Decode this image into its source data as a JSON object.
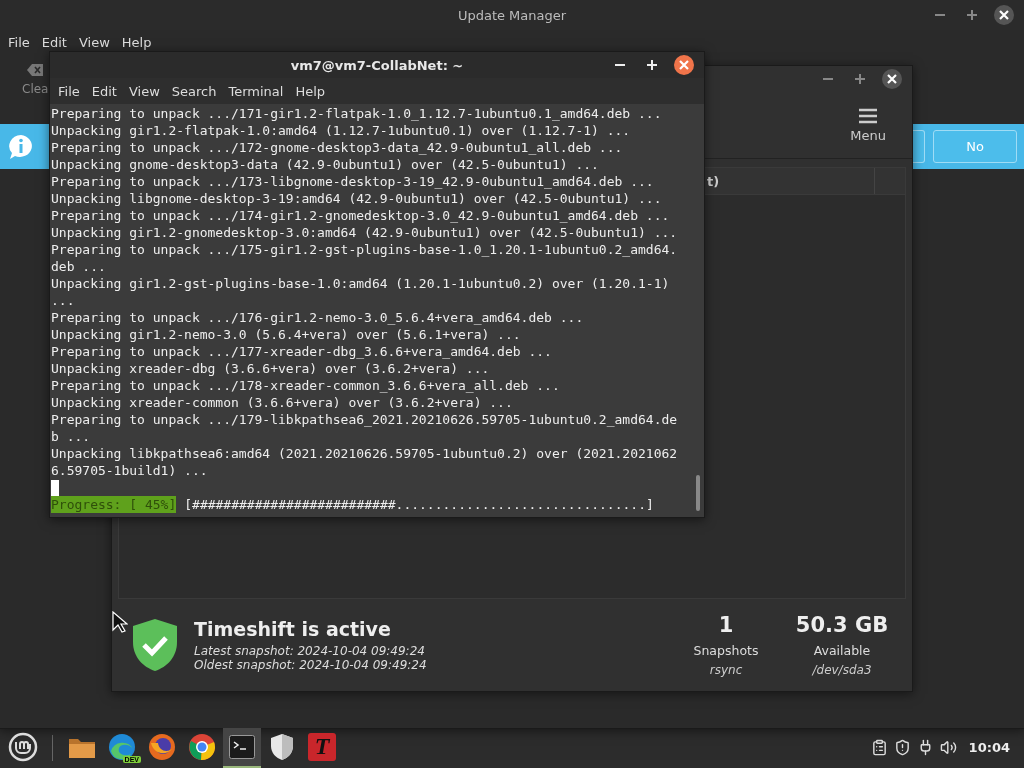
{
  "update_manager": {
    "title": "Update Manager",
    "focused": false,
    "menu": [
      "File",
      "Edit",
      "View",
      "Help"
    ],
    "toolbar_label": "Clea",
    "info_bar": {
      "buttons": [
        "No"
      ]
    }
  },
  "timeshift": {
    "toolbar_label": "Menu",
    "column_header": "t)",
    "status": {
      "title": "Timeshift is active",
      "latest": "Latest snapshot: 2024-10-04 09:49:24",
      "oldest": "Oldest snapshot: 2024-10-04 09:49:24",
      "stats": [
        {
          "value": "1",
          "label": "Snapshots",
          "sub": "rsync"
        },
        {
          "value": "50.3 GB",
          "label": "Available",
          "sub": "/dev/sda3"
        }
      ]
    }
  },
  "terminal": {
    "title": "vm7@vm7-CollabNet: ~",
    "focused": true,
    "menu": [
      "File",
      "Edit",
      "View",
      "Search",
      "Terminal",
      "Help"
    ],
    "lines": [
      "Preparing to unpack .../171-gir1.2-flatpak-1.0_1.12.7-1ubuntu0.1_amd64.deb ...",
      "Unpacking gir1.2-flatpak-1.0:amd64 (1.12.7-1ubuntu0.1) over (1.12.7-1) ...",
      "Preparing to unpack .../172-gnome-desktop3-data_42.9-0ubuntu1_all.deb ...",
      "Unpacking gnome-desktop3-data (42.9-0ubuntu1) over (42.5-0ubuntu1) ...",
      "Preparing to unpack .../173-libgnome-desktop-3-19_42.9-0ubuntu1_amd64.deb ...",
      "Unpacking libgnome-desktop-3-19:amd64 (42.9-0ubuntu1) over (42.5-0ubuntu1) ...",
      "Preparing to unpack .../174-gir1.2-gnomedesktop-3.0_42.9-0ubuntu1_amd64.deb ...",
      "Unpacking gir1.2-gnomedesktop-3.0:amd64 (42.9-0ubuntu1) over (42.5-0ubuntu1) ...",
      "Preparing to unpack .../175-gir1.2-gst-plugins-base-1.0_1.20.1-1ubuntu0.2_amd64.",
      "deb ...",
      "Unpacking gir1.2-gst-plugins-base-1.0:amd64 (1.20.1-1ubuntu0.2) over (1.20.1-1)",
      "...",
      "Preparing to unpack .../176-gir1.2-nemo-3.0_5.6.4+vera_amd64.deb ...",
      "Unpacking gir1.2-nemo-3.0 (5.6.4+vera) over (5.6.1+vera) ...",
      "Preparing to unpack .../177-xreader-dbg_3.6.6+vera_amd64.deb ...",
      "Unpacking xreader-dbg (3.6.6+vera) over (3.6.2+vera) ...",
      "Preparing to unpack .../178-xreader-common_3.6.6+vera_all.deb ...",
      "Unpacking xreader-common (3.6.6+vera) over (3.6.2+vera) ...",
      "Preparing to unpack .../179-libkpathsea6_2021.20210626.59705-1ubuntu0.2_amd64.de",
      "b ...",
      "Unpacking libkpathsea6:amd64 (2021.20210626.59705-1ubuntu0.2) over (2021.2021062",
      "6.59705-1build1) ..."
    ],
    "progress_label": "Progress: [ 45%]",
    "progress_bar": "[##########################................................]"
  },
  "taskbar": {
    "apps": [
      {
        "kind": "folder",
        "active": false
      },
      {
        "kind": "browser-dev",
        "badge": "DEV",
        "active": false
      },
      {
        "kind": "firefox",
        "active": false
      },
      {
        "kind": "chrome",
        "active": false
      },
      {
        "kind": "terminal",
        "active": true
      },
      {
        "kind": "shield",
        "active": false
      },
      {
        "kind": "font",
        "glyph": "T",
        "active": false
      }
    ],
    "clock": "10:04"
  }
}
